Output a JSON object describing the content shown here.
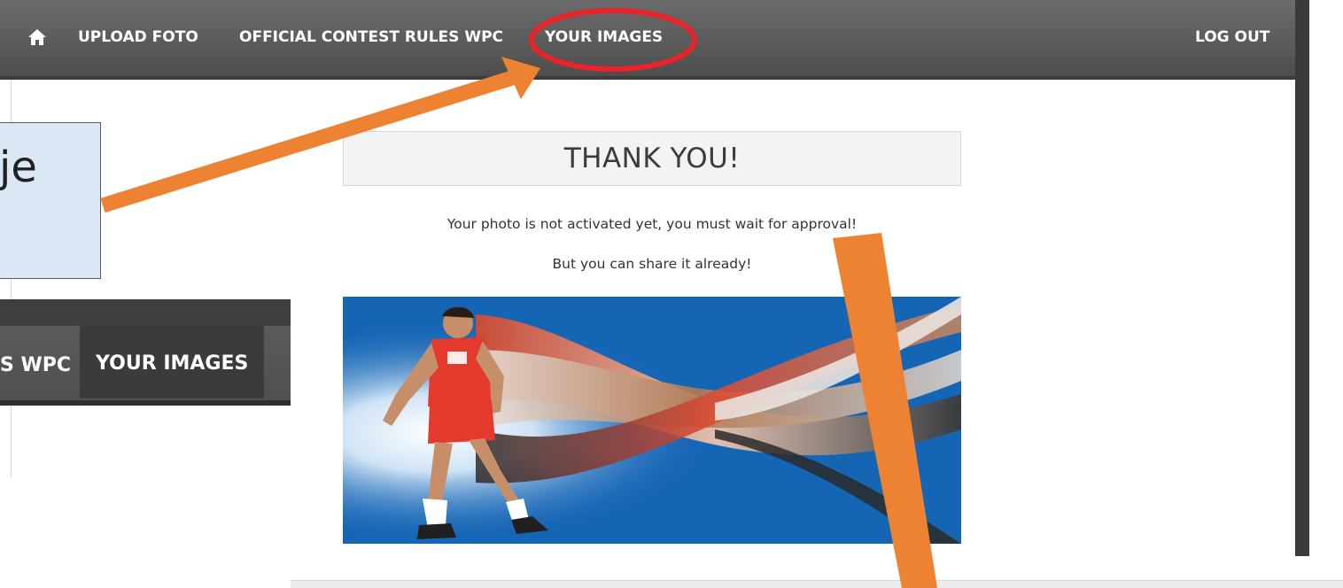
{
  "nav": {
    "home_icon": "home-icon",
    "upload": "UPLOAD FOTO",
    "rules": "OFFICIAL CONTEST RULES WPC",
    "your_images": "YOUR IMAGES",
    "logout": "LOG OUT"
  },
  "main": {
    "title": "THANK YOU!",
    "message_1": "Your photo is not activated yet, you must wait for approval!",
    "message_2": "But you can share it already!",
    "photo_icon": "volleyball-player-photo"
  },
  "callout": {
    "text": "je"
  },
  "inset": {
    "left_partial": "S WPC",
    "active": "YOUR IMAGES"
  },
  "colors": {
    "navbar": "#575757",
    "annotation_arrow": "#ee8233",
    "annotation_circle": "#e8232a",
    "callout_bg": "#dbe8f6",
    "photo_bg": "#1565b5"
  }
}
